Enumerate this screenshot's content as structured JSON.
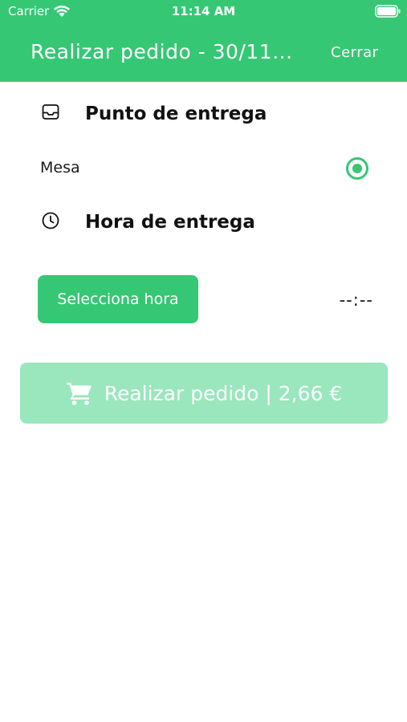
{
  "status_bar": {
    "carrier": "Carrier",
    "time": "11:14 AM"
  },
  "nav": {
    "title": "Realizar pedido - 30/11...",
    "close_label": "Cerrar"
  },
  "delivery_point": {
    "title": "Punto de entrega",
    "icon": "inbox-icon",
    "option_label": "Mesa",
    "selected": true
  },
  "delivery_time": {
    "title": "Hora de entrega",
    "icon": "clock-icon",
    "select_button_label": "Selecciona hora",
    "value": "--:--"
  },
  "order_button": {
    "label": "Realizar pedido | 2,66 €",
    "icon": "cart-icon",
    "enabled": false
  },
  "colors": {
    "brand_green": "#36c774",
    "disabled_green": "#9ae6bd"
  }
}
